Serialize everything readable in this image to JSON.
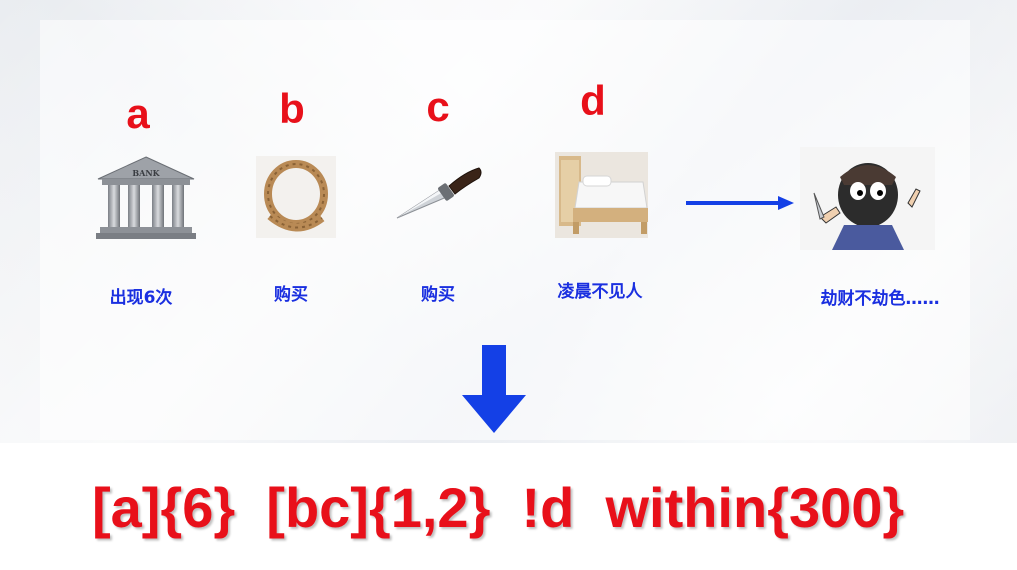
{
  "events": [
    {
      "letter": "a",
      "caption": "出现6次",
      "icon": "bank-icon"
    },
    {
      "letter": "b",
      "caption": "购买",
      "icon": "rope-icon"
    },
    {
      "letter": "c",
      "caption": "购买",
      "icon": "knife-icon"
    },
    {
      "letter": "d",
      "caption": "凌晨不见人",
      "icon": "bed-icon"
    }
  ],
  "result": {
    "caption": "劫财不劫色……",
    "icon": "robber-icon"
  },
  "formula": "[a]{6}  [bc]{1,2}  !d  within{300}",
  "colors": {
    "letter": "#e8101a",
    "caption": "#1a2fe0",
    "arrow": "#1440e6",
    "formula": "#e8101a"
  },
  "bank_sign": "BANK"
}
